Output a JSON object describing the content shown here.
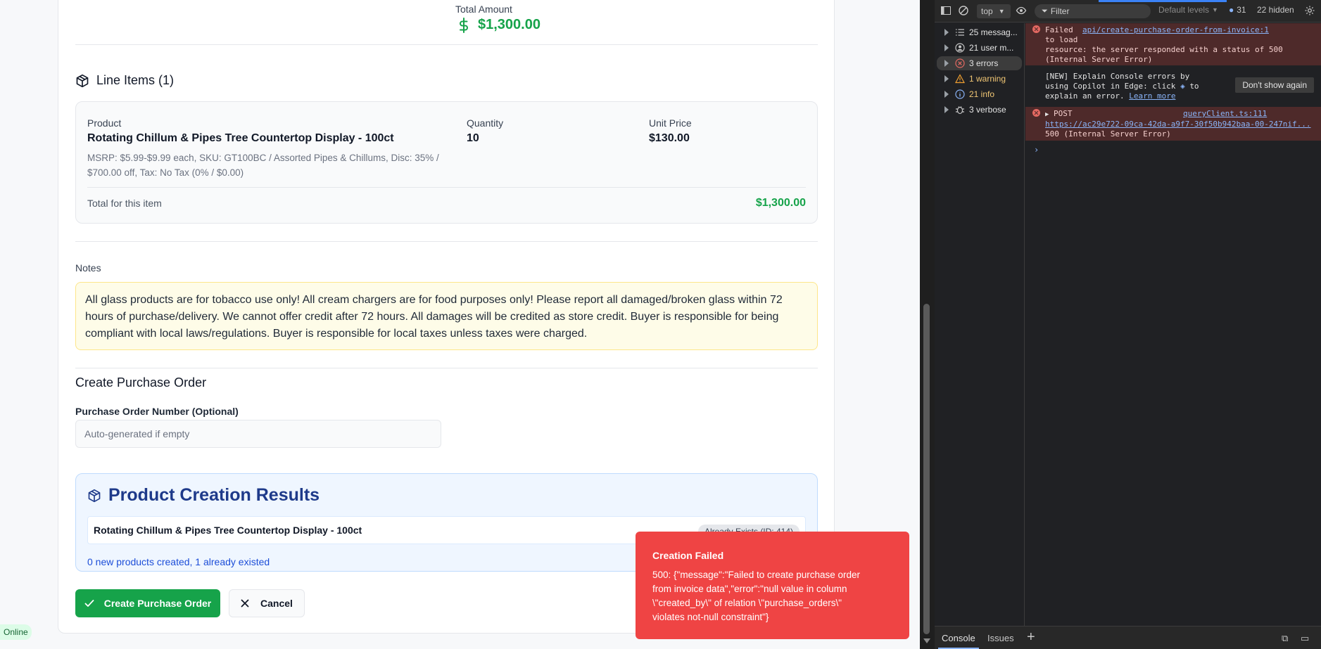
{
  "invoice": {
    "total_label": "Total Amount",
    "total_value": "$1,300.00"
  },
  "line_items": {
    "title": "Line Items (1)",
    "items": [
      {
        "product_label": "Product",
        "product_name": "Rotating Chillum & Pipes Tree Countertop Display - 100ct",
        "meta": "MSRP: $5.99-$9.99 each, SKU: GT100BC / Assorted Pipes & Chillums, Disc: 35% / $700.00 off, Tax: No Tax (0% / $0.00)",
        "quantity_label": "Quantity",
        "quantity": "10",
        "unit_price_label": "Unit Price",
        "unit_price": "$130.00",
        "total_label": "Total for this item",
        "total_value": "$1,300.00"
      }
    ]
  },
  "notes": {
    "label": "Notes",
    "text": "All glass products are for tobacco use only! All cream chargers are for food purposes only! Please report all damaged/broken glass within 72 hours of purchase/delivery. We cannot offer credit after 72 hours. All damages will be credited as store credit. Buyer is responsible for being compliant with local laws/regulations. Buyer is responsible for local taxes unless taxes were charged."
  },
  "create_po": {
    "title": "Create Purchase Order",
    "po_number_label": "Purchase Order Number (Optional)",
    "po_number_value": "",
    "po_number_placeholder": "Auto-generated if empty"
  },
  "product_results": {
    "title": "Product Creation Results",
    "rows": [
      {
        "name": "Rotating Chillum & Pipes Tree Countertop Display - 100ct",
        "badge": "Already Exists (ID: 414)"
      }
    ],
    "summary": "0 new products created, 1 already existed"
  },
  "actions": {
    "create_label": "Create Purchase Order",
    "cancel_label": "Cancel"
  },
  "status": {
    "online_label": "Online"
  },
  "toast": {
    "title": "Creation Failed",
    "body": "500: {\"message\":\"Failed to create purchase order from invoice data\",\"error\":\"null value in column \\\"created_by\\\" of relation \\\"purchase_orders\\\" violates not-null constraint\"}"
  },
  "devtools": {
    "context": "top",
    "filter_placeholder": "Filter",
    "levels": "Default levels",
    "issues_count": "31",
    "hidden": "22 hidden",
    "sidebar": [
      {
        "label": "25 messag...",
        "icon": "list-icon"
      },
      {
        "label": "21 user m...",
        "icon": "user-icon"
      },
      {
        "label": "3 errors",
        "icon": "error-icon"
      },
      {
        "label": "1 warning",
        "icon": "warning-icon"
      },
      {
        "label": "21 info",
        "icon": "info-icon"
      },
      {
        "label": "3 verbose",
        "icon": "bug-icon"
      }
    ],
    "messages": {
      "err1_prefix": "Failed",
      "err1_link": "api/create-purchase-order-from-invoice:1",
      "err1_line2": "to load",
      "err1_line3": "resource: the server responded with a status of 500",
      "err1_line4": "(Internal Server Error)",
      "copilot_line1": "[NEW] Explain Console errors by",
      "copilot_line2a": "using Copilot in Edge: click",
      "copilot_line2b": "to",
      "copilot_line3a": "explain an error.",
      "copilot_link": "Learn more",
      "dont_show": "Don't show again",
      "err2_method": "POST",
      "err2_source": "queryClient.ts:111",
      "err2_url": "https://ac29e722-09ca-42da-a9f7-30f50b942baa-00-247nif...",
      "err2_status": "500 (Internal Server Error)"
    },
    "tabs": [
      "Console",
      "Issues"
    ]
  }
}
